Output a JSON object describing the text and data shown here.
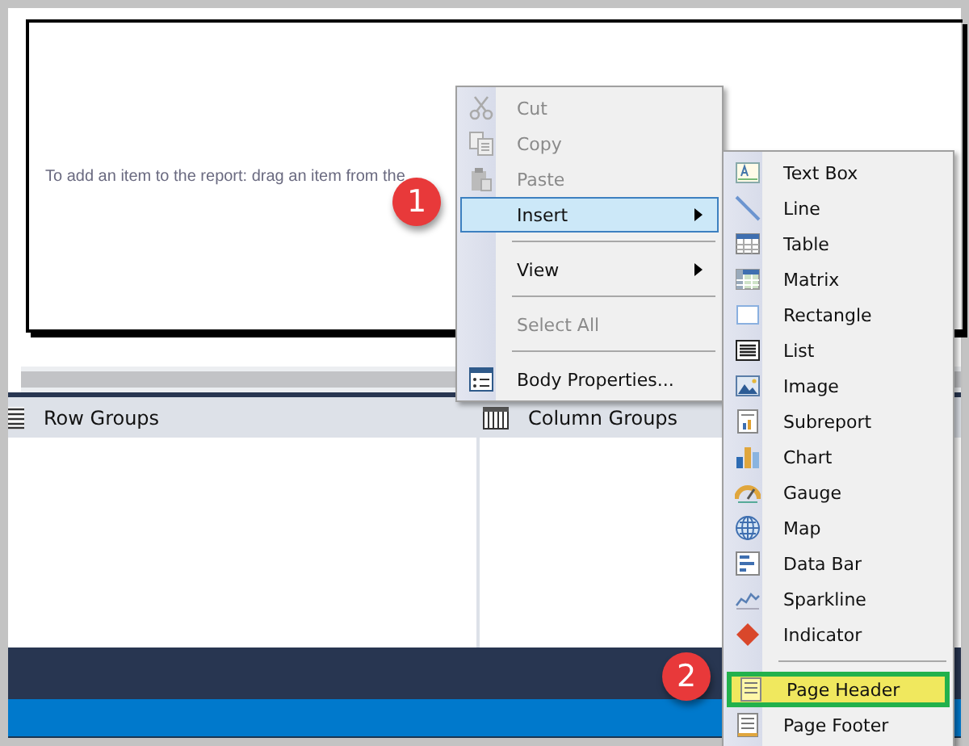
{
  "design_surface": {
    "hint": "To add an item to the report: drag an item from the"
  },
  "groups_pane": {
    "row_groups": "Row Groups",
    "column_groups": "Column Groups"
  },
  "context_menu": {
    "items": [
      {
        "kind": "item",
        "label": "Cut",
        "disabled": true,
        "selected": false,
        "submenu": false
      },
      {
        "kind": "item",
        "label": "Copy",
        "disabled": true,
        "selected": false,
        "submenu": false
      },
      {
        "kind": "item",
        "label": "Paste",
        "disabled": true,
        "selected": false,
        "submenu": false
      },
      {
        "kind": "item",
        "label": "Insert",
        "disabled": false,
        "selected": true,
        "submenu": true
      },
      {
        "kind": "separator"
      },
      {
        "kind": "item",
        "label": "View",
        "disabled": false,
        "selected": false,
        "submenu": true
      },
      {
        "kind": "separator"
      },
      {
        "kind": "item",
        "label": "Select All",
        "disabled": true,
        "selected": false,
        "submenu": false
      },
      {
        "kind": "separator"
      },
      {
        "kind": "item",
        "label": "Body Properties...",
        "disabled": false,
        "selected": false,
        "submenu": false
      }
    ]
  },
  "insert_submenu": {
    "items": [
      {
        "kind": "item",
        "label": "Text Box",
        "selected": false
      },
      {
        "kind": "item",
        "label": "Line",
        "selected": false
      },
      {
        "kind": "item",
        "label": "Table",
        "selected": false
      },
      {
        "kind": "item",
        "label": "Matrix",
        "selected": false
      },
      {
        "kind": "item",
        "label": "Rectangle",
        "selected": false
      },
      {
        "kind": "item",
        "label": "List",
        "selected": false
      },
      {
        "kind": "item",
        "label": "Image",
        "selected": false
      },
      {
        "kind": "item",
        "label": "Subreport",
        "selected": false
      },
      {
        "kind": "item",
        "label": "Chart",
        "selected": false
      },
      {
        "kind": "item",
        "label": "Gauge",
        "selected": false
      },
      {
        "kind": "item",
        "label": "Map",
        "selected": false
      },
      {
        "kind": "item",
        "label": "Data Bar",
        "selected": false
      },
      {
        "kind": "item",
        "label": "Sparkline",
        "selected": false
      },
      {
        "kind": "item",
        "label": "Indicator",
        "selected": false
      },
      {
        "kind": "separator"
      },
      {
        "kind": "item",
        "label": "Page Header",
        "selected": true
      },
      {
        "kind": "item",
        "label": "Page Footer",
        "selected": false
      }
    ]
  },
  "callouts": [
    {
      "label": "1"
    },
    {
      "label": "2"
    }
  ]
}
